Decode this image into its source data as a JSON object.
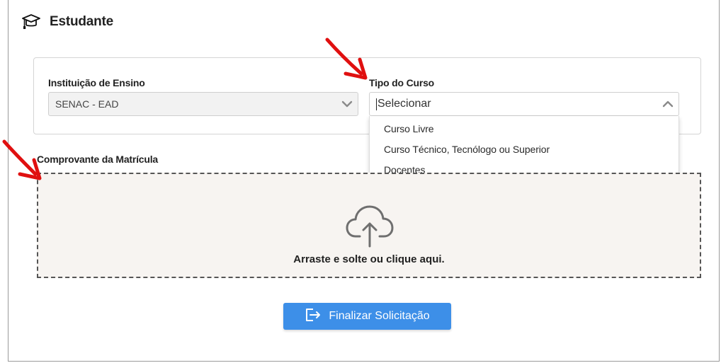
{
  "header": {
    "title": "Estudante",
    "icon": "graduation-cap-icon"
  },
  "form": {
    "institution": {
      "label": "Instituição de Ensino",
      "value": "SENAC - EAD",
      "icon": "chevron-down-icon"
    },
    "course_type": {
      "label": "Tipo do Curso",
      "placeholder": "Selecionar",
      "icon": "chevron-up-icon",
      "options": [
        "Curso Livre",
        "Curso Técnico, Tecnólogo ou Superior",
        "Docentes"
      ]
    },
    "upload": {
      "label": "Comprovante da Matrícula",
      "prompt": "Arraste e solte ou clique aqui.",
      "icon": "cloud-upload-icon"
    }
  },
  "submit": {
    "label": "Finalizar Solicitação",
    "icon": "sign-out-icon"
  },
  "colors": {
    "primary": "#3d8fe8",
    "annotation_arrow": "#e01010",
    "upload_bg": "#f7f4f1"
  }
}
